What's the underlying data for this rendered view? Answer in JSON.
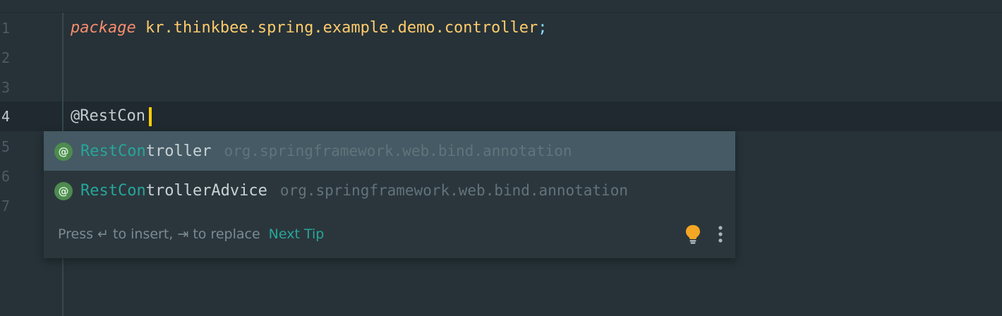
{
  "editor": {
    "line_numbers": [
      "1",
      "2",
      "3",
      "4",
      "5",
      "6",
      "7"
    ],
    "line1": {
      "keyword": "package",
      "package_name": "kr.thinkbee.spring.example.demo.controller",
      "semicolon": ";"
    },
    "line4": {
      "typed": "@RestCon"
    }
  },
  "completion": {
    "items": [
      {
        "match": "RestCon",
        "rest": "troller",
        "package": "org.springframework.web.bind.annotation",
        "icon": "@",
        "selected": true
      },
      {
        "match": "RestCon",
        "rest": "trollerAdvice",
        "package": "org.springframework.web.bind.annotation",
        "icon": "@",
        "selected": false
      }
    ],
    "footer": {
      "hint_press": "Press ",
      "enter_glyph": "↵",
      "hint_insert": " to insert, ",
      "tab_glyph": "⇥",
      "hint_replace": " to replace",
      "next_tip": "Next Tip"
    }
  },
  "colors": {
    "background": "#263238",
    "keyword": "#f78c6c",
    "package": "#ffcb6b",
    "match": "#26a69a",
    "caret": "#ffcc00",
    "bulb": "#f5a623"
  }
}
